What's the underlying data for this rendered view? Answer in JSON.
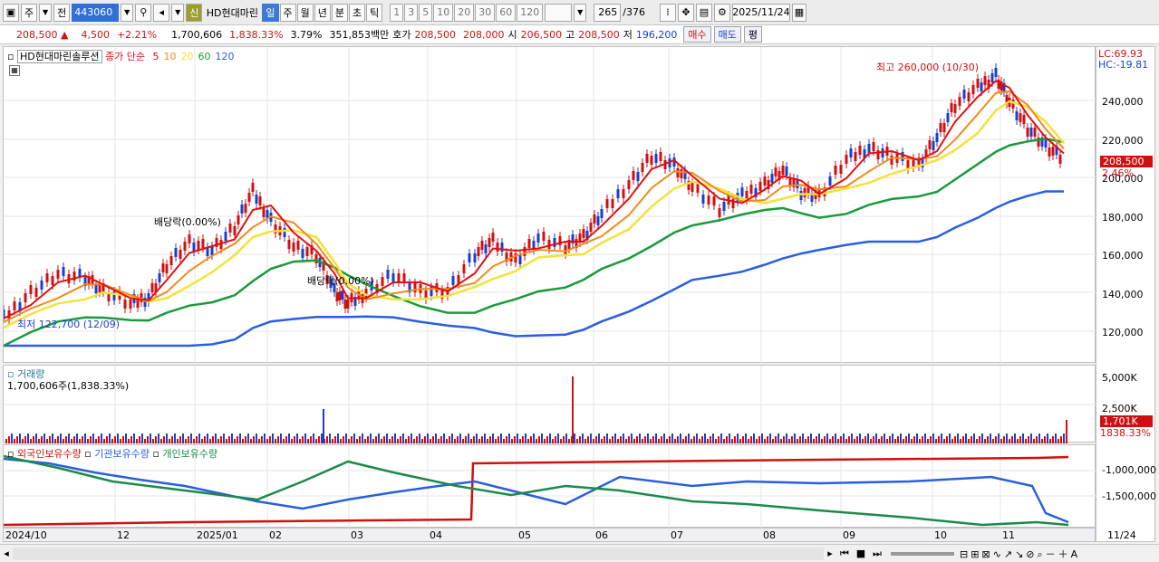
{
  "toolbar": {
    "type_label": "주",
    "prev_label": "전",
    "code": "443060",
    "new_label": "신",
    "stock_name": "HD현대마린",
    "periods": [
      "일",
      "주",
      "월",
      "년",
      "분",
      "초",
      "틱"
    ],
    "active_period": "일",
    "intervals": [
      "1",
      "3",
      "5",
      "10",
      "20",
      "30",
      "60",
      "120"
    ],
    "count": "265",
    "total": "/376",
    "date": "2025/11/24"
  },
  "quote": {
    "price": "208,500",
    "change": "4,500",
    "change_pct": "+2.21%",
    "volume": "1,700,606",
    "volume_pct": "1,838.33%",
    "turnover_pct": "3.79%",
    "amount": "351,853백만",
    "bid_label": "호가",
    "bid1": "208,500",
    "bid2": "208,000",
    "open_label": "시",
    "open": "206,500",
    "high_label": "고",
    "high": "208,500",
    "low_label": "저",
    "low": "196,200",
    "buy_label": "매수",
    "sell_label": "매도",
    "eval_label": "평"
  },
  "chart": {
    "legend_name": "HD현대마린솔루션",
    "legend_ma": "종가 단순",
    "ma_periods": [
      "5",
      "10",
      "20",
      "60",
      "120"
    ],
    "annotations": {
      "high": "최고 260,000 (10/30)",
      "low": "최저 122,700 (12/09)",
      "div1": "배당락(0.00%)",
      "div2": "배당락(0.00%)"
    },
    "lc": "LC:69.93",
    "hc": "HC:-19.81",
    "price_tag": "208,500",
    "pct_tag": "2.46%",
    "yticks": [
      "240,000",
      "220,000",
      "200,000",
      "180,000",
      "160,000",
      "140,000",
      "120,000"
    ]
  },
  "volume": {
    "title": "거래량",
    "value": "1,700,606주(1,838.33%)",
    "yticks": [
      "5,000K",
      "2,500K"
    ],
    "tag": "1,701K",
    "tag_pct": "1838.33%"
  },
  "investor": {
    "foreign": "외국인보유수량",
    "institution": "기관보유수량",
    "individual": "개인보유수량",
    "yticks": [
      "-1,000,000",
      "-1,500,000"
    ]
  },
  "xaxis": [
    "2024/10",
    "12",
    "2025/01",
    "02",
    "03",
    "04",
    "05",
    "06",
    "07",
    "08",
    "09",
    "10",
    "11"
  ],
  "xaxis_end": "11/24",
  "colors": {
    "ma5": "#e01010",
    "ma10": "#f08a1c",
    "ma20": "#f2e23a",
    "ma60": "#1a9a3a",
    "ma120": "#2a5ee0"
  }
}
